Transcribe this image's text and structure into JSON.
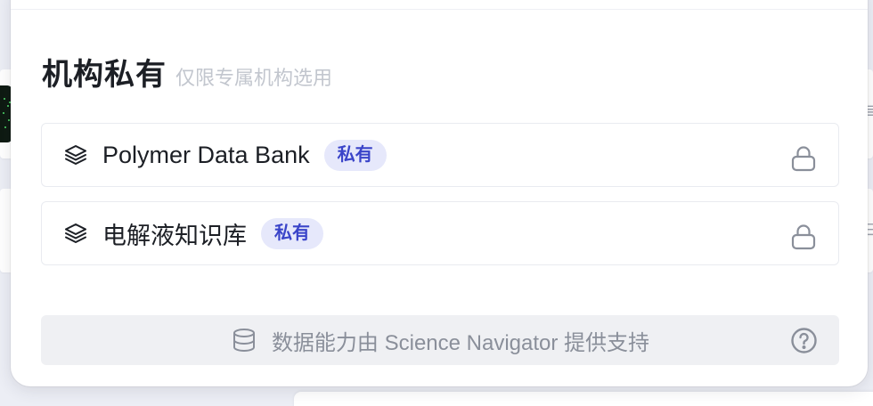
{
  "section": {
    "title": "机构私有",
    "subtitle": "仅限专属机构选用"
  },
  "knowledge_bases": [
    {
      "name": "Polymer Data Bank",
      "badge": "私有",
      "icon": "layers-icon",
      "status_icon": "lock-icon"
    },
    {
      "name": "电解液知识库",
      "badge": "私有",
      "icon": "layers-icon",
      "status_icon": "lock-icon"
    }
  ],
  "footer": {
    "text": "数据能力由 Science Navigator 提供支持",
    "icon": "database-icon",
    "help_icon": "help-circle-icon"
  },
  "background": {
    "glyph_top": "≣",
    "glyph_bottom": "∋"
  },
  "colors": {
    "badge_bg": "#e6e8fb",
    "badge_text": "#3a44c9",
    "title": "#1c1f25",
    "subtitle": "#c2c6ce",
    "footer_bg": "#eff0f3",
    "footer_text": "#8a8f9a"
  }
}
